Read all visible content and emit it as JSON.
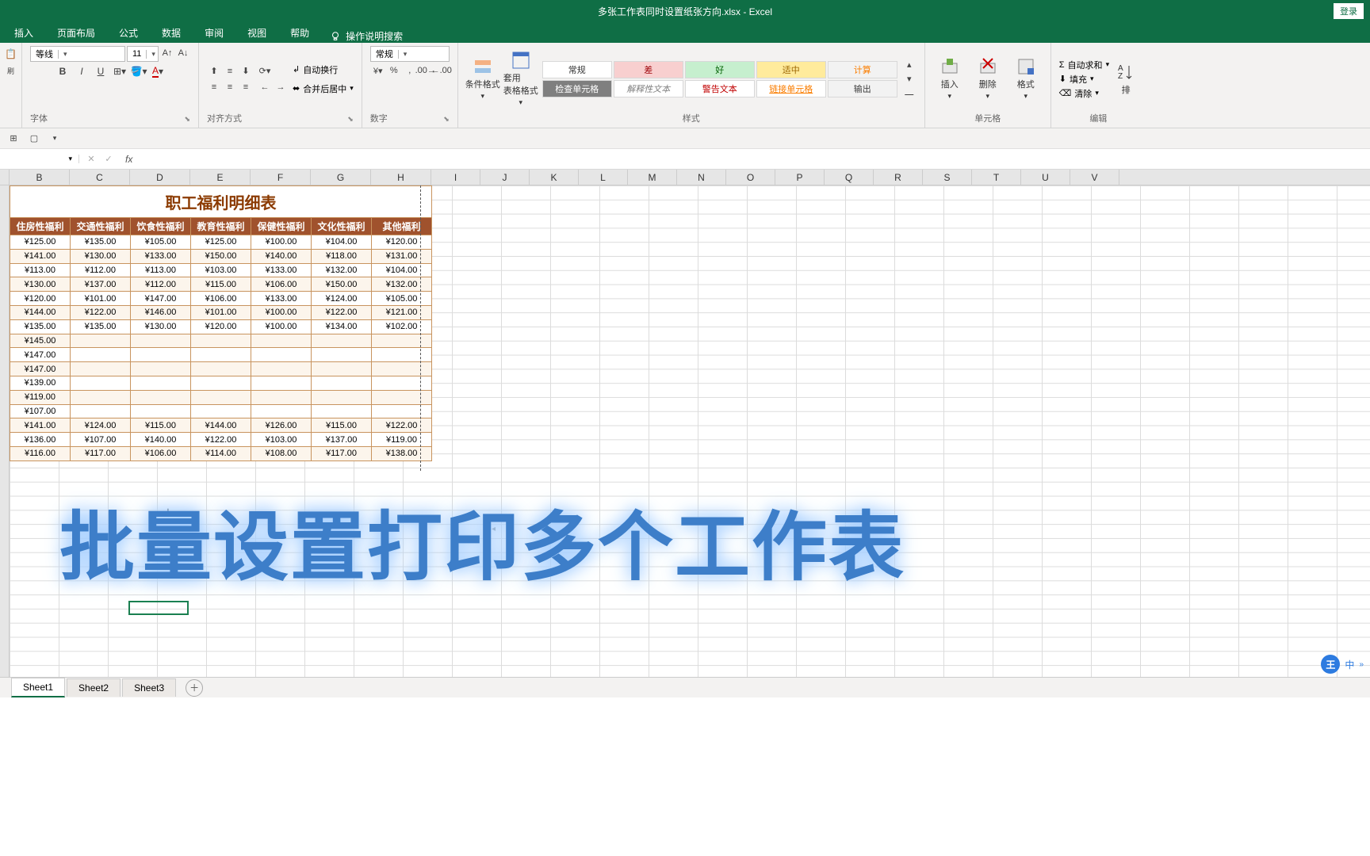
{
  "title": "多张工作表同时设置纸张方向.xlsx - Excel",
  "login": "登录",
  "menu": [
    "插入",
    "页面布局",
    "公式",
    "数据",
    "审阅",
    "视图",
    "帮助"
  ],
  "tellme": "操作说明搜索",
  "font": {
    "name": "等线",
    "size": "11",
    "group": "字体"
  },
  "align": {
    "wrap": "自动换行",
    "merge": "合并后居中",
    "group": "对齐方式"
  },
  "number": {
    "format": "常规",
    "group": "数字"
  },
  "cond": {
    "a": "条件格式",
    "b": "套用\n表格格式"
  },
  "styles": {
    "group": "样式",
    "cells": [
      {
        "t": "常规",
        "bg": "#fff",
        "c": "#333"
      },
      {
        "t": "差",
        "bg": "#f8cfcf",
        "c": "#9c0006"
      },
      {
        "t": "好",
        "bg": "#c6efce",
        "c": "#006100"
      },
      {
        "t": "适中",
        "bg": "#ffeb9c",
        "c": "#9c6500"
      },
      {
        "t": "计算",
        "bg": "#f2f2f2",
        "c": "#fa7d00"
      },
      {
        "t": "检查单元格",
        "bg": "#7f7f7f",
        "c": "#fff"
      },
      {
        "t": "解释性文本",
        "bg": "#fff",
        "c": "#7f7f7f",
        "i": true
      },
      {
        "t": "警告文本",
        "bg": "#fff",
        "c": "#c00000"
      },
      {
        "t": "链接单元格",
        "bg": "#fff",
        "c": "#fa7d00",
        "u": true
      },
      {
        "t": "输出",
        "bg": "#f2f2f2",
        "c": "#3f3f3f"
      }
    ]
  },
  "cells": {
    "insert": "插入",
    "delete": "删除",
    "format": "格式",
    "group": "单元格"
  },
  "edit": {
    "sum": "自动求和",
    "fill": "填充",
    "clear": "清除",
    "sort": "排",
    "group": "编辑"
  },
  "columns": [
    "B",
    "C",
    "D",
    "E",
    "F",
    "G",
    "H",
    "I",
    "J",
    "K",
    "L",
    "M",
    "N",
    "O",
    "P",
    "Q",
    "R",
    "S",
    "T",
    "U",
    "V"
  ],
  "table": {
    "title": "职工福利明细表",
    "headers": [
      "住房性福利",
      "交通性福利",
      "饮食性福利",
      "教育性福利",
      "保健性福利",
      "文化性福利",
      "其他福利"
    ],
    "rows": [
      [
        "¥125.00",
        "¥135.00",
        "¥105.00",
        "¥125.00",
        "¥100.00",
        "¥104.00",
        "¥120.00"
      ],
      [
        "¥141.00",
        "¥130.00",
        "¥133.00",
        "¥150.00",
        "¥140.00",
        "¥118.00",
        "¥131.00"
      ],
      [
        "¥113.00",
        "¥112.00",
        "¥113.00",
        "¥103.00",
        "¥133.00",
        "¥132.00",
        "¥104.00"
      ],
      [
        "¥130.00",
        "¥137.00",
        "¥112.00",
        "¥115.00",
        "¥106.00",
        "¥150.00",
        "¥132.00"
      ],
      [
        "¥120.00",
        "¥101.00",
        "¥147.00",
        "¥106.00",
        "¥133.00",
        "¥124.00",
        "¥105.00"
      ],
      [
        "¥144.00",
        "¥122.00",
        "¥146.00",
        "¥101.00",
        "¥100.00",
        "¥122.00",
        "¥121.00"
      ],
      [
        "¥135.00",
        "¥135.00",
        "¥130.00",
        "¥120.00",
        "¥100.00",
        "¥134.00",
        "¥102.00"
      ],
      [
        "¥145.00",
        "",
        "",
        "",
        "",
        "",
        ""
      ],
      [
        "¥147.00",
        "",
        "",
        "",
        "",
        "",
        ""
      ],
      [
        "¥147.00",
        "",
        "",
        "",
        "",
        "",
        ""
      ],
      [
        "¥139.00",
        "",
        "",
        "",
        "",
        "",
        ""
      ],
      [
        "¥119.00",
        "",
        "",
        "",
        "",
        "",
        ""
      ],
      [
        "¥107.00",
        "",
        "",
        "",
        "",
        "",
        ""
      ],
      [
        "¥141.00",
        "¥124.00",
        "¥115.00",
        "¥144.00",
        "¥126.00",
        "¥115.00",
        "¥122.00"
      ],
      [
        "¥136.00",
        "¥107.00",
        "¥140.00",
        "¥122.00",
        "¥103.00",
        "¥137.00",
        "¥119.00"
      ],
      [
        "¥116.00",
        "¥117.00",
        "¥106.00",
        "¥114.00",
        "¥108.00",
        "¥117.00",
        "¥138.00"
      ]
    ]
  },
  "overlay": "批量设置打印多个工作表",
  "sheets": [
    "Sheet1",
    "Sheet2",
    "Sheet3"
  ],
  "ime": {
    "badge": "王",
    "lang": "中"
  },
  "colwidths": {
    "first": 12,
    "data": 76,
    "rest": 62
  }
}
